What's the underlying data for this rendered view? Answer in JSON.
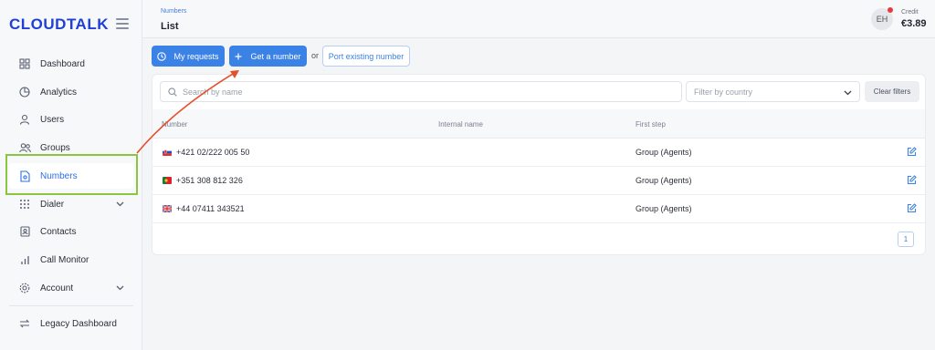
{
  "app": {
    "logo": "CLOUDTALK"
  },
  "sidebar": {
    "items": [
      {
        "label": "Dashboard",
        "icon": "grid-icon"
      },
      {
        "label": "Analytics",
        "icon": "pie-chart-icon"
      },
      {
        "label": "Users",
        "icon": "user-icon"
      },
      {
        "label": "Groups",
        "icon": "users-icon"
      },
      {
        "label": "Numbers",
        "icon": "file-icon",
        "active": true
      },
      {
        "label": "Dialer",
        "icon": "dialpad-icon"
      },
      {
        "label": "Contacts",
        "icon": "contact-icon"
      },
      {
        "label": "Call Monitor",
        "icon": "bar-chart-icon"
      },
      {
        "label": "Account",
        "icon": "gear-icon"
      },
      {
        "label": "Legacy Dashboard",
        "icon": "swap-icon"
      }
    ]
  },
  "header": {
    "breadcrumb": "Numbers",
    "title": "List",
    "avatar_initials": "EH",
    "credit_label": "Credit",
    "credit_value": "€3.89"
  },
  "actions": {
    "my_requests": "My requests",
    "get_number": "Get a number",
    "or": "or",
    "port_existing": "Port existing number"
  },
  "filters": {
    "search_placeholder": "Search by name",
    "country_placeholder": "Filter by country",
    "clear": "Clear filters"
  },
  "table": {
    "columns": [
      "Number",
      "Internal name",
      "First step"
    ],
    "rows": [
      {
        "flag": "SK",
        "number": "+421 02/222 005 50",
        "internal_name": "",
        "first_step": "Group (Agents)"
      },
      {
        "flag": "PT",
        "number": "+351 308 812 326",
        "internal_name": "",
        "first_step": "Group (Agents)"
      },
      {
        "flag": "GB",
        "number": "+44 07411 343521",
        "internal_name": "",
        "first_step": "Group (Agents)"
      }
    ]
  },
  "pagination": {
    "current": "1"
  },
  "colors": {
    "accent": "#3b82e6",
    "brand": "#1f3fd9",
    "highlight": "#8cc63f",
    "arrow": "#e4502e"
  }
}
